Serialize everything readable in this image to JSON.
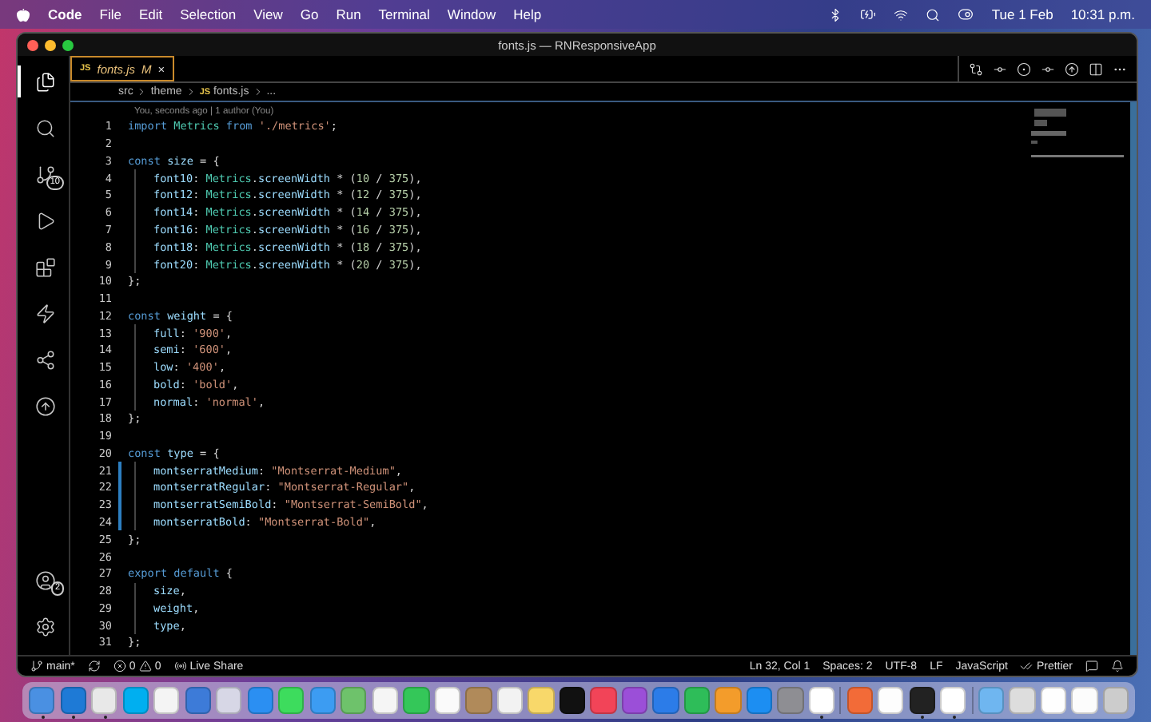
{
  "menu_bar": {
    "app": "Code",
    "items": [
      "File",
      "Edit",
      "Selection",
      "View",
      "Go",
      "Run",
      "Terminal",
      "Window",
      "Help"
    ],
    "date": "Tue 1 Feb",
    "time": "10:31 p.m."
  },
  "window": {
    "title": "fonts.js — RNResponsiveApp"
  },
  "activity_bar": [
    {
      "kind": "files",
      "selected": true
    },
    {
      "kind": "search",
      "selected": false
    },
    {
      "kind": "source-control",
      "selected": false,
      "badge": "10"
    },
    {
      "kind": "run",
      "selected": false
    },
    {
      "kind": "extensions",
      "selected": false
    },
    {
      "kind": "lightning",
      "selected": false
    },
    {
      "kind": "live-share",
      "selected": false
    },
    {
      "kind": "git-graph",
      "selected": false
    }
  ],
  "activity_bottom": [
    {
      "kind": "account",
      "badge": "2"
    },
    {
      "kind": "settings"
    }
  ],
  "tabs": [
    {
      "icon": "JS",
      "label": "fonts.js",
      "status": "M",
      "close": "×",
      "selected": true
    }
  ],
  "breadcrumbs": [
    {
      "label": "src"
    },
    {
      "label": "theme"
    },
    {
      "icon": "JS",
      "label": "fonts.js"
    },
    {
      "label": "..."
    }
  ],
  "codelens": "You, seconds ago | 1 author (You)",
  "code_lines": [
    {
      "number": "1",
      "indented": false,
      "changed": false,
      "tokens": [
        {
          "kind": "kw",
          "text": "import "
        },
        {
          "kind": "cls",
          "text": "Metrics "
        },
        {
          "kind": "kw",
          "text": "from "
        },
        {
          "kind": "str",
          "text": "'./metrics'"
        },
        {
          "kind": "p",
          "text": ";"
        }
      ]
    },
    {
      "number": "2",
      "indented": false,
      "changed": false
    },
    {
      "number": "3",
      "indented": false,
      "changed": false,
      "tokens": [
        {
          "kind": "kw",
          "text": "const "
        },
        {
          "kind": "id",
          "text": "size "
        },
        {
          "kind": "p",
          "text": "= {"
        }
      ]
    },
    {
      "number": "4",
      "indented": true,
      "changed": false,
      "tokens": [
        {
          "kind": "id",
          "text": "font10"
        },
        {
          "kind": "p",
          "text": ": "
        },
        {
          "kind": "cls",
          "text": "Metrics"
        },
        {
          "kind": "p",
          "text": "."
        },
        {
          "kind": "id",
          "text": "screenWidth "
        },
        {
          "kind": "p",
          "text": "* ("
        },
        {
          "kind": "num",
          "text": "10"
        },
        {
          "kind": "p",
          "text": " / "
        },
        {
          "kind": "num",
          "text": "375"
        },
        {
          "kind": "p",
          "text": "),"
        }
      ]
    },
    {
      "number": "5",
      "indented": true,
      "changed": false,
      "tokens": [
        {
          "kind": "id",
          "text": "font12"
        },
        {
          "kind": "p",
          "text": ": "
        },
        {
          "kind": "cls",
          "text": "Metrics"
        },
        {
          "kind": "p",
          "text": "."
        },
        {
          "kind": "id",
          "text": "screenWidth "
        },
        {
          "kind": "p",
          "text": "* ("
        },
        {
          "kind": "num",
          "text": "12"
        },
        {
          "kind": "p",
          "text": " / "
        },
        {
          "kind": "num",
          "text": "375"
        },
        {
          "kind": "p",
          "text": "),"
        }
      ]
    },
    {
      "number": "6",
      "indented": true,
      "changed": false,
      "tokens": [
        {
          "kind": "id",
          "text": "font14"
        },
        {
          "kind": "p",
          "text": ": "
        },
        {
          "kind": "cls",
          "text": "Metrics"
        },
        {
          "kind": "p",
          "text": "."
        },
        {
          "kind": "id",
          "text": "screenWidth "
        },
        {
          "kind": "p",
          "text": "* ("
        },
        {
          "kind": "num",
          "text": "14"
        },
        {
          "kind": "p",
          "text": " / "
        },
        {
          "kind": "num",
          "text": "375"
        },
        {
          "kind": "p",
          "text": "),"
        }
      ]
    },
    {
      "number": "7",
      "indented": true,
      "changed": false,
      "tokens": [
        {
          "kind": "id",
          "text": "font16"
        },
        {
          "kind": "p",
          "text": ": "
        },
        {
          "kind": "cls",
          "text": "Metrics"
        },
        {
          "kind": "p",
          "text": "."
        },
        {
          "kind": "id",
          "text": "screenWidth "
        },
        {
          "kind": "p",
          "text": "* ("
        },
        {
          "kind": "num",
          "text": "16"
        },
        {
          "kind": "p",
          "text": " / "
        },
        {
          "kind": "num",
          "text": "375"
        },
        {
          "kind": "p",
          "text": "),"
        }
      ]
    },
    {
      "number": "8",
      "indented": true,
      "changed": false,
      "tokens": [
        {
          "kind": "id",
          "text": "font18"
        },
        {
          "kind": "p",
          "text": ": "
        },
        {
          "kind": "cls",
          "text": "Metrics"
        },
        {
          "kind": "p",
          "text": "."
        },
        {
          "kind": "id",
          "text": "screenWidth "
        },
        {
          "kind": "p",
          "text": "* ("
        },
        {
          "kind": "num",
          "text": "18"
        },
        {
          "kind": "p",
          "text": " / "
        },
        {
          "kind": "num",
          "text": "375"
        },
        {
          "kind": "p",
          "text": "),"
        }
      ]
    },
    {
      "number": "9",
      "indented": true,
      "changed": false,
      "tokens": [
        {
          "kind": "id",
          "text": "font20"
        },
        {
          "kind": "p",
          "text": ": "
        },
        {
          "kind": "cls",
          "text": "Metrics"
        },
        {
          "kind": "p",
          "text": "."
        },
        {
          "kind": "id",
          "text": "screenWidth "
        },
        {
          "kind": "p",
          "text": "* ("
        },
        {
          "kind": "num",
          "text": "20"
        },
        {
          "kind": "p",
          "text": " / "
        },
        {
          "kind": "num",
          "text": "375"
        },
        {
          "kind": "p",
          "text": "),"
        }
      ]
    },
    {
      "number": "10",
      "indented": false,
      "changed": false,
      "tokens": [
        {
          "kind": "p",
          "text": "};"
        }
      ]
    },
    {
      "number": "11",
      "indented": false,
      "changed": false
    },
    {
      "number": "12",
      "indented": false,
      "changed": false,
      "tokens": [
        {
          "kind": "kw",
          "text": "const "
        },
        {
          "kind": "id",
          "text": "weight "
        },
        {
          "kind": "p",
          "text": "= {"
        }
      ]
    },
    {
      "number": "13",
      "indented": true,
      "changed": false,
      "tokens": [
        {
          "kind": "id",
          "text": "full"
        },
        {
          "kind": "p",
          "text": ": "
        },
        {
          "kind": "str",
          "text": "'900'"
        },
        {
          "kind": "p",
          "text": ","
        }
      ]
    },
    {
      "number": "14",
      "indented": true,
      "changed": false,
      "tokens": [
        {
          "kind": "id",
          "text": "semi"
        },
        {
          "kind": "p",
          "text": ": "
        },
        {
          "kind": "str",
          "text": "'600'"
        },
        {
          "kind": "p",
          "text": ","
        }
      ]
    },
    {
      "number": "15",
      "indented": true,
      "changed": false,
      "tokens": [
        {
          "kind": "id",
          "text": "low"
        },
        {
          "kind": "p",
          "text": ": "
        },
        {
          "kind": "str",
          "text": "'400'"
        },
        {
          "kind": "p",
          "text": ","
        }
      ]
    },
    {
      "number": "16",
      "indented": true,
      "changed": false,
      "tokens": [
        {
          "kind": "id",
          "text": "bold"
        },
        {
          "kind": "p",
          "text": ": "
        },
        {
          "kind": "str",
          "text": "'bold'"
        },
        {
          "kind": "p",
          "text": ","
        }
      ]
    },
    {
      "number": "17",
      "indented": true,
      "changed": false,
      "tokens": [
        {
          "kind": "id",
          "text": "normal"
        },
        {
          "kind": "p",
          "text": ": "
        },
        {
          "kind": "str",
          "text": "'normal'"
        },
        {
          "kind": "p",
          "text": ","
        }
      ]
    },
    {
      "number": "18",
      "indented": false,
      "changed": false,
      "tokens": [
        {
          "kind": "p",
          "text": "};"
        }
      ]
    },
    {
      "number": "19",
      "indented": false,
      "changed": false
    },
    {
      "number": "20",
      "indented": false,
      "changed": false,
      "tokens": [
        {
          "kind": "kw",
          "text": "const "
        },
        {
          "kind": "id",
          "text": "type "
        },
        {
          "kind": "p",
          "text": "= {"
        }
      ]
    },
    {
      "number": "21",
      "indented": true,
      "changed": true,
      "tokens": [
        {
          "kind": "id",
          "text": "montserratMedium"
        },
        {
          "kind": "p",
          "text": ": "
        },
        {
          "kind": "str",
          "text": "\"Montserrat-Medium\""
        },
        {
          "kind": "p",
          "text": ","
        }
      ]
    },
    {
      "number": "22",
      "indented": true,
      "changed": true,
      "tokens": [
        {
          "kind": "id",
          "text": "montserratRegular"
        },
        {
          "kind": "p",
          "text": ": "
        },
        {
          "kind": "str",
          "text": "\"Montserrat-Regular\""
        },
        {
          "kind": "p",
          "text": ","
        }
      ]
    },
    {
      "number": "23",
      "indented": true,
      "changed": true,
      "tokens": [
        {
          "kind": "id",
          "text": "montserratSemiBold"
        },
        {
          "kind": "p",
          "text": ": "
        },
        {
          "kind": "str",
          "text": "\"Montserrat-SemiBold\""
        },
        {
          "kind": "p",
          "text": ","
        }
      ]
    },
    {
      "number": "24",
      "indented": true,
      "changed": true,
      "tokens": [
        {
          "kind": "id",
          "text": "montserratBold"
        },
        {
          "kind": "p",
          "text": ": "
        },
        {
          "kind": "str",
          "text": "\"Montserrat-Bold\""
        },
        {
          "kind": "p",
          "text": ","
        }
      ]
    },
    {
      "number": "25",
      "indented": false,
      "changed": false,
      "tokens": [
        {
          "kind": "p",
          "text": "};"
        }
      ]
    },
    {
      "number": "26",
      "indented": false,
      "changed": false
    },
    {
      "number": "27",
      "indented": false,
      "changed": false,
      "tokens": [
        {
          "kind": "kw",
          "text": "export default "
        },
        {
          "kind": "p",
          "text": "{"
        }
      ]
    },
    {
      "number": "28",
      "indented": true,
      "changed": false,
      "tokens": [
        {
          "kind": "id",
          "text": "size"
        },
        {
          "kind": "p",
          "text": ","
        }
      ]
    },
    {
      "number": "29",
      "indented": true,
      "changed": false,
      "tokens": [
        {
          "kind": "id",
          "text": "weight"
        },
        {
          "kind": "p",
          "text": ","
        }
      ]
    },
    {
      "number": "30",
      "indented": true,
      "changed": false,
      "tokens": [
        {
          "kind": "id",
          "text": "type"
        },
        {
          "kind": "p",
          "text": ","
        }
      ]
    },
    {
      "number": "31",
      "indented": false,
      "changed": false,
      "tokens": [
        {
          "kind": "p",
          "text": "};"
        }
      ]
    }
  ],
  "status_bar": {
    "branch": "main*",
    "errors": "0",
    "warnings": "0",
    "live_share": "Live Share",
    "right": [
      "Ln 32, Col 1",
      "Spaces: 2",
      "UTF-8",
      "LF",
      "JavaScript"
    ],
    "prettier": "Prettier"
  },
  "dock": [
    {
      "color": "#4a90e2",
      "running": true
    },
    {
      "color": "#1e7ad6",
      "running": true
    },
    {
      "color": "#e8e8e8",
      "running": true
    },
    {
      "color": "#00aff0",
      "running": false
    },
    {
      "color": "#f4f4f4",
      "running": false
    },
    {
      "color": "#3d7bd8",
      "running": false
    },
    {
      "color": "#d7d7e6",
      "running": false
    },
    {
      "color": "#2b8ff2",
      "running": false
    },
    {
      "color": "#3ddc5d",
      "running": false
    },
    {
      "color": "#3c9cf2",
      "running": false
    },
    {
      "color": "#6ec26b",
      "running": false
    },
    {
      "color": "#f5f5f5",
      "running": false
    },
    {
      "color": "#34c759",
      "running": false
    },
    {
      "color": "#fafafa",
      "running": false
    },
    {
      "color": "#b08a5a",
      "running": false
    },
    {
      "color": "#f2f2f2",
      "running": false
    },
    {
      "color": "#f8d86a",
      "running": false
    },
    {
      "color": "#111111",
      "running": false
    },
    {
      "color": "#f24458",
      "running": false
    },
    {
      "color": "#9b4fd8",
      "running": false
    },
    {
      "color": "#2c7ce8",
      "running": false
    },
    {
      "color": "#2ebd59",
      "running": false
    },
    {
      "color": "#f39c2b",
      "running": false
    },
    {
      "color": "#1c8ef2",
      "running": false
    },
    {
      "color": "#8e8e93",
      "running": false
    },
    {
      "color": "#ffffff",
      "running": true
    },
    {
      "color": "#f26b38",
      "running": false
    },
    {
      "color": "#fdfdfd",
      "running": false
    },
    {
      "color": "#222222",
      "running": true
    },
    {
      "color": "#ffffff",
      "running": true
    },
    {
      "color": "#6fb6f0",
      "running": false
    },
    {
      "color": "#dddddd",
      "running": false
    },
    {
      "color": "#fefefe",
      "running": false
    },
    {
      "color": "#fcfcfc",
      "running": false
    },
    {
      "color": "#cccccc",
      "running": false
    }
  ]
}
